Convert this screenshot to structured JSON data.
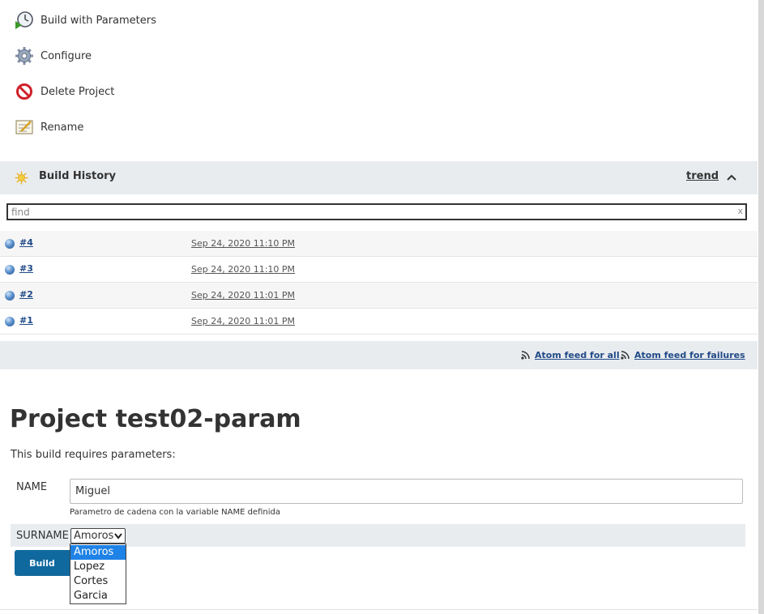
{
  "tasks": [
    {
      "label": "Build with Parameters",
      "icon": "clock-play-icon"
    },
    {
      "label": "Configure",
      "icon": "gear-icon"
    },
    {
      "label": "Delete Project",
      "icon": "no-entry-icon"
    },
    {
      "label": "Rename",
      "icon": "notepad-icon"
    }
  ],
  "build_history": {
    "title": "Build History",
    "trend_label": "trend",
    "find_placeholder": "find",
    "find_clear": "x",
    "builds": [
      {
        "number": "#4",
        "date": "Sep 24, 2020 11:10 PM",
        "status_color": "#5d93cf"
      },
      {
        "number": "#3",
        "date": "Sep 24, 2020 11:10 PM",
        "status_color": "#5d93cf"
      },
      {
        "number": "#2",
        "date": "Sep 24, 2020 11:01 PM",
        "status_color": "#5d93cf"
      },
      {
        "number": "#1",
        "date": "Sep 24, 2020 11:01 PM",
        "status_color": "#5d93cf"
      }
    ],
    "feed_all": "Atom feed for all",
    "feed_failures": "Atom feed for failures"
  },
  "project": {
    "title": "Project test02-param",
    "params_intro": "This build requires parameters:",
    "name_label": "NAME",
    "name_value": "Miguel",
    "name_help": "Parametro de cadena con la variable NAME definida",
    "surname_label": "SURNAME",
    "surname_selected": "Amoros",
    "surname_options": [
      "Amoros",
      "Lopez",
      "Cortes",
      "Garcia"
    ],
    "build_button": "Build"
  },
  "colors": {
    "accent": "#10699e",
    "link": "#204a87",
    "panel": "#e9ecef",
    "option_highlight": "#1e82e6"
  }
}
